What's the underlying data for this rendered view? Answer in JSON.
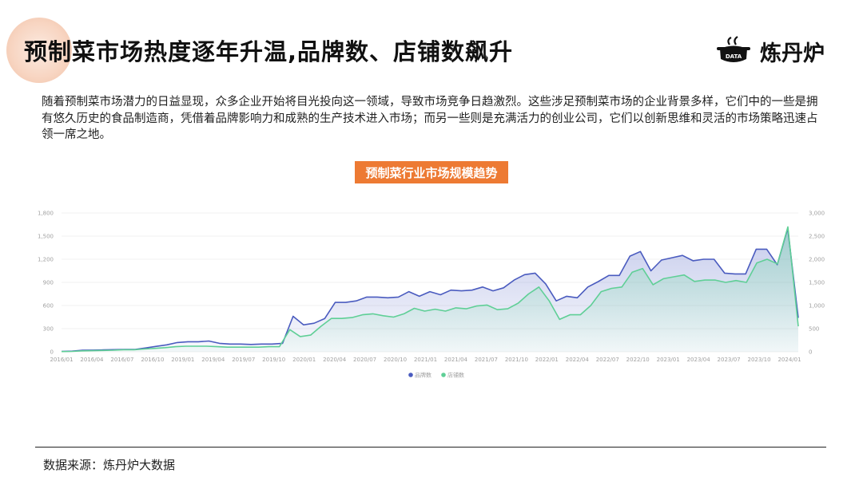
{
  "header": {
    "title": "预制菜市场热度逐年升温,品牌数、店铺数飙升",
    "brand_name": "炼丹炉",
    "brand_logo_text": "DATA"
  },
  "description": "随着预制菜市场潜力的日益显现，众多企业开始将目光投向这一领域，导致市场竞争日趋激烈。这些涉足预制菜市场的企业背景多样，它们中的一些是拥有悠久历史的食品制造商，凭借着品牌影响力和成熟的生产技术进入市场；而另一些则是充满活力的创业公司，它们以创新思维和灵活的市场策略迅速占领一席之地。",
  "footer": {
    "source": "数据来源：炼丹炉大数据"
  },
  "colors": {
    "brand_series": "#4a5bbf",
    "store_series": "#5fcf96",
    "title_badge": "#ed7a33"
  },
  "chart_data": {
    "type": "area",
    "title": "预制菜行业市场规模趋势",
    "x_tick_labels": [
      "2016/01",
      "2016/04",
      "2016/07",
      "2016/10",
      "2019/01",
      "2019/04",
      "2019/07",
      "2019/10",
      "2020/01",
      "2020/04",
      "2020/07",
      "2020/10",
      "2021/01",
      "2021/04",
      "2021/07",
      "2021/10",
      "2022/01",
      "2022/04",
      "2022/07",
      "2022/10",
      "2023/01",
      "2023/04",
      "2023/07",
      "2023/10",
      "2024/01"
    ],
    "left_axis": {
      "ticks": [
        "0",
        "300",
        "600",
        "900",
        "1,200",
        "1,500",
        "1,800"
      ],
      "ylim": [
        0,
        1800
      ]
    },
    "right_axis": {
      "ticks": [
        "0",
        "500",
        "1,000",
        "1,500",
        "2,000",
        "2,500",
        "3,000"
      ],
      "ylim": [
        0,
        3000
      ]
    },
    "legend": {
      "position": "bottom",
      "entries": [
        "品牌数",
        "店铺数"
      ]
    },
    "series": [
      {
        "name": "品牌数",
        "axis": "left",
        "color": "#4a5bbf",
        "values": [
          5,
          8,
          20,
          22,
          25,
          28,
          30,
          30,
          50,
          70,
          90,
          120,
          130,
          130,
          140,
          110,
          100,
          100,
          95,
          100,
          100,
          110,
          460,
          350,
          370,
          430,
          640,
          640,
          660,
          710,
          710,
          700,
          710,
          780,
          720,
          780,
          740,
          800,
          790,
          800,
          840,
          790,
          830,
          930,
          1000,
          1020,
          880,
          660,
          720,
          700,
          840,
          910,
          990,
          990,
          1240,
          1300,
          1050,
          1190,
          1220,
          1250,
          1180,
          1200,
          1200,
          1020,
          1010,
          1010,
          1330,
          1330,
          1130,
          1600,
          440
        ]
      },
      {
        "name": "店铺数",
        "axis": "right",
        "color": "#5fcf96",
        "values": [
          5,
          8,
          20,
          25,
          30,
          35,
          45,
          45,
          60,
          75,
          90,
          110,
          120,
          120,
          120,
          110,
          100,
          100,
          100,
          100,
          110,
          110,
          480,
          330,
          360,
          550,
          720,
          720,
          740,
          800,
          820,
          780,
          750,
          820,
          940,
          880,
          920,
          880,
          950,
          930,
          990,
          1010,
          910,
          930,
          1050,
          1250,
          1400,
          1100,
          700,
          800,
          800,
          1000,
          1300,
          1370,
          1400,
          1720,
          1800,
          1450,
          1580,
          1620,
          1660,
          1520,
          1550,
          1550,
          1500,
          1540,
          1500,
          1920,
          2000,
          1900,
          2700,
          550
        ]
      }
    ]
  }
}
